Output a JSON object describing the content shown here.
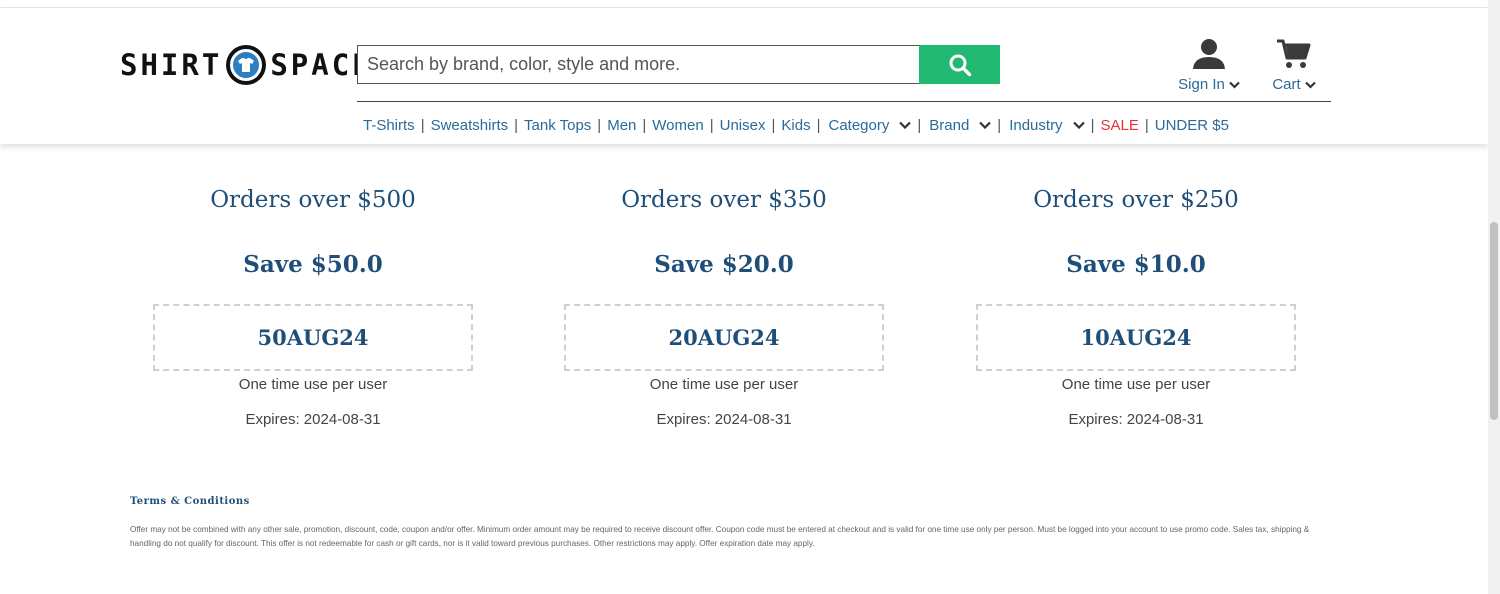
{
  "header": {
    "logo_left": "SHIRT",
    "logo_right": "SPACE",
    "search_placeholder": "Search by brand, color, style and more.",
    "account_label": "Sign In",
    "cart_label": "Cart"
  },
  "nav": {
    "items": [
      {
        "label": "T-Shirts"
      },
      {
        "label": "Sweatshirts"
      },
      {
        "label": "Tank Tops"
      },
      {
        "label": "Men"
      },
      {
        "label": "Women"
      },
      {
        "label": "Unisex"
      },
      {
        "label": "Kids"
      },
      {
        "label": "Category"
      },
      {
        "label": "Brand"
      },
      {
        "label": "Industry"
      },
      {
        "label": "SALE"
      },
      {
        "label": "UNDER $5"
      }
    ]
  },
  "offers": [
    {
      "title": "Orders over $500",
      "save": "Save $50.0",
      "code": "50AUG24",
      "note": "One time use per user",
      "expires": "Expires: 2024-08-31"
    },
    {
      "title": "Orders over $350",
      "save": "Save $20.0",
      "code": "20AUG24",
      "note": "One time use per user",
      "expires": "Expires: 2024-08-31"
    },
    {
      "title": "Orders over $250",
      "save": "Save $10.0",
      "code": "10AUG24",
      "note": "One time use per user",
      "expires": "Expires: 2024-08-31"
    }
  ],
  "terms": {
    "title": "Terms & Conditions",
    "text": "Offer may not be combined with any other sale, promotion, discount, code, coupon and/or offer. Minimum order amount may be required to receive discount offer. Coupon code must be entered at checkout and is valid for one time use only per person. Must be logged into your account to use promo code. Sales tax, shipping & handling do not qualify for discount. This offer is not redeemable for cash or gift cards, nor is it valid toward previous purchases. Other restrictions may apply. Offer expiration date may apply."
  },
  "colors": {
    "accent_green": "#21b872",
    "link_blue": "#2a6b9a",
    "heading_blue": "#1f4f78",
    "sale_red": "#e53535"
  },
  "icons": [
    "tshirt-logo-icon",
    "search-icon",
    "user-icon",
    "chevron-down-icon",
    "cart-icon"
  ]
}
